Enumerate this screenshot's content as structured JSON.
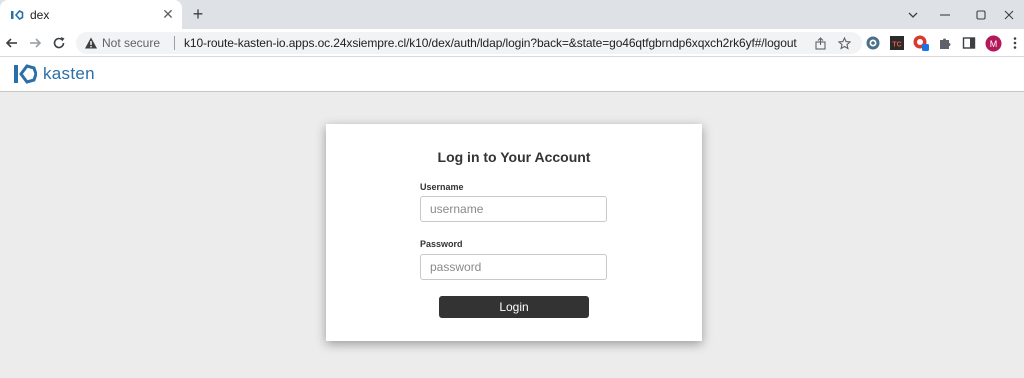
{
  "browser": {
    "tab": {
      "title": "dex",
      "close_glyph": "✕"
    },
    "new_tab_glyph": "+",
    "window_controls": {
      "minimize": "─",
      "restore": "☐",
      "close": "✕",
      "menu": "⌄"
    },
    "omnibox": {
      "security_label": "Not secure",
      "url": "k10-route-kasten-io.apps.oc.24xsiempre.cl/k10/dex/auth/ldap/login?back=&state=go46qtfgbrndp6xqxch2rk6yf#/logout"
    },
    "profile_initial": "M",
    "extensions": {
      "tc_label": "TC"
    }
  },
  "app": {
    "logo_text": "kasten",
    "brand_color": "#2a6fa8"
  },
  "login": {
    "title": "Log in to Your Account",
    "username_label": "Username",
    "username_placeholder": "username",
    "password_label": "Password",
    "password_placeholder": "password",
    "submit_label": "Login"
  }
}
